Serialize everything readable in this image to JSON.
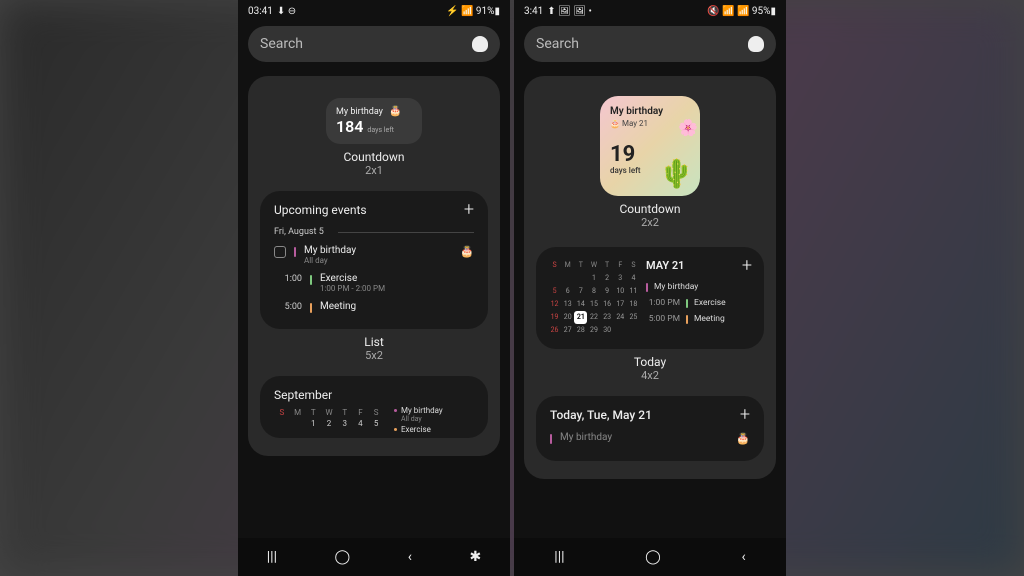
{
  "left": {
    "status": {
      "time": "03:41",
      "icons_left": "⬇ ⊖",
      "icons_right": "⚡ 📶 91%▮"
    },
    "search_placeholder": "Search",
    "countdown2x1": {
      "title": "My birthday",
      "cake": "🎂",
      "days": "184",
      "days_left": "days left",
      "widget_name": "Countdown",
      "widget_size": "2x1"
    },
    "list5x2": {
      "title": "Upcoming events",
      "date": "Fri, August 5",
      "events": [
        {
          "time_icon": "cal",
          "title": "My birthday",
          "sub": "All day",
          "color": "#b85c9e",
          "cake": "🎂"
        },
        {
          "time": "1:00",
          "title": "Exercise",
          "sub": "1:00 PM - 2:00 PM",
          "color": "#7fc97f"
        },
        {
          "time": "5:00",
          "title": "Meeting",
          "sub": "",
          "color": "#e8a05c"
        }
      ],
      "widget_name": "List",
      "widget_size": "5x2"
    },
    "cal": {
      "title": "September",
      "dow": [
        "S",
        "M",
        "T",
        "W",
        "T",
        "F",
        "S"
      ],
      "rows": [
        [
          "",
          "",
          "1",
          "2",
          "3",
          "4",
          "5"
        ]
      ],
      "side_events": [
        {
          "title": "My birthday",
          "sub": "All day",
          "color": "#b85c9e"
        },
        {
          "title": "Exercise",
          "sub": "",
          "color": "#e8a05c"
        }
      ]
    }
  },
  "right": {
    "status": {
      "time": "3:41",
      "icons_left": "⬆ 🖼 🖼 •",
      "icons_right": "🔇 📶 📶 95%▮"
    },
    "search_placeholder": "Search",
    "countdown2x2": {
      "title": "My birthday",
      "cake": "🎂",
      "date": "May 21",
      "days": "19",
      "days_left": "days left",
      "widget_name": "Countdown",
      "widget_size": "2x2"
    },
    "today4x2": {
      "month_title": "MAY 21",
      "dow": [
        "S",
        "M",
        "T",
        "W",
        "T",
        "F",
        "S"
      ],
      "rows": [
        [
          "",
          "",
          "",
          "1",
          "2",
          "3",
          "4"
        ],
        [
          "5",
          "6",
          "7",
          "8",
          "9",
          "10",
          "11"
        ],
        [
          "12",
          "13",
          "14",
          "15",
          "16",
          "17",
          "18"
        ],
        [
          "19",
          "20",
          "21",
          "22",
          "23",
          "24",
          "25"
        ],
        [
          "26",
          "27",
          "28",
          "29",
          "30",
          "",
          ""
        ]
      ],
      "today_cell": "21",
      "events": [
        {
          "time": "",
          "title": "My birthday",
          "color": "#b85c9e"
        },
        {
          "time": "1:00 PM",
          "title": "Exercise",
          "color": "#7fc97f"
        },
        {
          "time": "5:00 PM",
          "title": "Meeting",
          "color": "#e8a05c"
        }
      ],
      "widget_name": "Today",
      "widget_size": "4x2"
    },
    "today_list": {
      "title": "Today, Tue, May 21",
      "event0": "My birthday"
    }
  },
  "nav": {
    "recent": "|||",
    "home": "◯",
    "back": "‹",
    "a11y": "✱"
  }
}
